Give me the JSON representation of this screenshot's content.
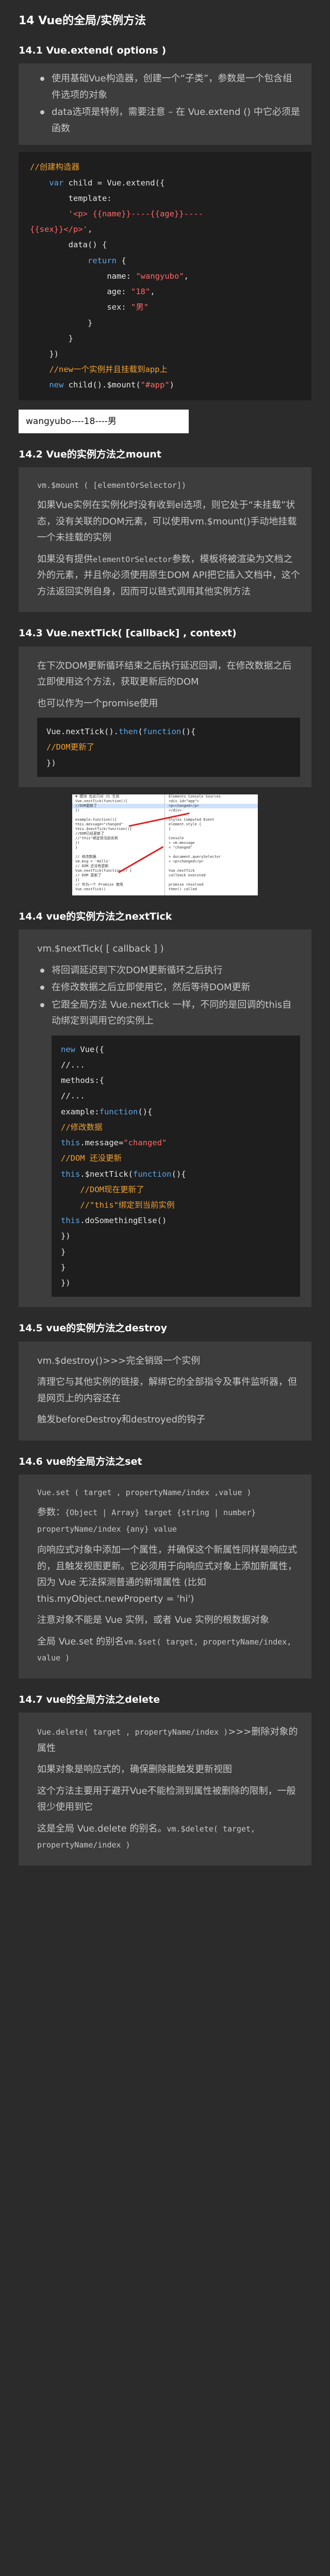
{
  "title": "14 Vue的全局/实例方法",
  "sections": {
    "s1": {
      "heading": "14.1 Vue.extend( options )",
      "bullets": [
        "使用基础Vue构造器，创建一个“子类”，参数是一个包含组件选项的对象",
        "data选项是特例，需要注意 – 在 Vue.extend () 中它必须是函数"
      ],
      "code_comment": "//创建构造器",
      "code_new_comment": "//new一个实例并且挂载到app上",
      "result_text": "wangyubo----18----男"
    },
    "s2": {
      "heading": "14.2 Vue的实例方法之mount",
      "signature": "vm.$mount ( [elementOrSelector])",
      "para1": "如果Vue实例在实例化时没有收到el选项，则它处于“未挂载”状态，没有关联的DOM元素，可以使用vm.$mount()手动地挂载一个未挂载的实例",
      "para2_a": "如果没有提供",
      "para2_code": "elementOrSelector",
      "para2_b": "参数，模板将被渲染为文档之外的元素，并且你必须使用原生DOM API把它插入文档中，这个方法返回实例自身，因而可以链式调用其他实例方法"
    },
    "s3": {
      "heading": "14.3 Vue.nextTick( [callback] , context)",
      "para1": "在下次DOM更新循环结束之后执行延迟回调，在修改数据之后立即使用这个方法，获取更新后的DOM",
      "para2": "也可以作为一个promise使用",
      "code_comment": "//DOM更新了",
      "shot": {
        "left_rows": [
          "▼ 模块  在此只对 JS 生效",
          "  Vue.nextTick(function(){",
          "    //DOM更新了",
          "  })",
          "",
          "  example:function(){",
          "    this.message=\"changed\"",
          "    this.$nextTick(function(){",
          "      //DOM已经更新了",
          "      //\"this\"绑定到当前实例",
          "    })",
          "  }",
          "",
          "  // 修改数据",
          "  vm.msg = 'Hello'",
          "  // DOM 还没有更新",
          "  Vue.nextTick(function () {",
          "    // DOM 更新了",
          "  })",
          "  // 作为一个 Promise 使用",
          "  Vue.nextTick()"
        ],
        "right_rows": [
          "Elements  Console  Sources",
          "<div id=\"app\">",
          "  <p>changed</p>",
          "</div>",
          "",
          "Styles  Computed  Event",
          "element.style {",
          "}",
          "",
          "Console",
          "> vm.message",
          "< \"changed\"",
          "",
          "> document.querySelector",
          "< <p>changed</p>",
          "",
          "Vue.nextTick",
          "  callback executed",
          "",
          "promise resolved",
          "  then() called"
        ]
      }
    },
    "s4": {
      "heading": "14.4 vue的实例方法之nextTick",
      "signature": "vm.$nextTick( [ callback ] )",
      "bullets": [
        "将回调延迟到下次DOM更新循环之后执行",
        "在修改数据之后立即使用它，然后等待DOM更新",
        "它跟全局方法 Vue.nextTick 一样，不同的是回调的this自动绑定到调用它的实例上"
      ],
      "code_c1": "//修改数据",
      "code_c2": "//DOM 还没更新",
      "code_c3": "//DOM现在更新了",
      "code_c4": "//\"this\"绑定到当前实例",
      "code_str": "\"changed\""
    },
    "s5": {
      "heading": "14.5 vue的实例方法之destroy",
      "signature": "vm.$destroy()>>>完全销毁一个实例",
      "para1": "清理它与其他实例的链接，解绑它的全部指令及事件监听器，但是网页上的内容还在",
      "para2": "触发beforeDestroy和destroyed的钩子"
    },
    "s6": {
      "heading": "14.6 vue的全局方法之set",
      "signature": "Vue.set ( target , propertyName/index ,value )",
      "params_label": "参数：",
      "params_code": "{Object | Array} target {string | number} propertyName/index {any} value",
      "para1": "向响应式对象中添加一个属性，并确保这个新属性同样是响应式的，且触发视图更新。它必须用于向响应式对象上添加新属性，因为 Vue 无法探测普通的新增属性 (比如 this.myObject.newProperty = 'hi')",
      "para2": "注意对象不能是 Vue 实例，或者 Vue 实例的根数据对象",
      "para3_a": "全局 Vue.set 的别名",
      "para3_code": "vm.$set( target, propertyName/index, value )"
    },
    "s7": {
      "heading": "14.7 vue的全局方法之delete",
      "signature_code": "Vue.delete( target , propertyName/index )",
      "signature_tail": ">>>删除对象的属性",
      "para1": "如果对象是响应式的，确保删除能触发更新视图",
      "para2": "这个方法主要用于避开Vue不能检测到属性被删除的限制，一般很少使用到它",
      "para3_a": "这是全局 Vue.delete 的别名。",
      "para3_code": "vm.$delete( target, propertyName/index )"
    }
  },
  "colors": {
    "background": "#2b2b2b",
    "quote_bg": "#3d3d3d",
    "code_bg": "#1e1e1e",
    "keyword": "#5ba6e6",
    "string": "#ff6666",
    "comment": "#f0a030"
  }
}
